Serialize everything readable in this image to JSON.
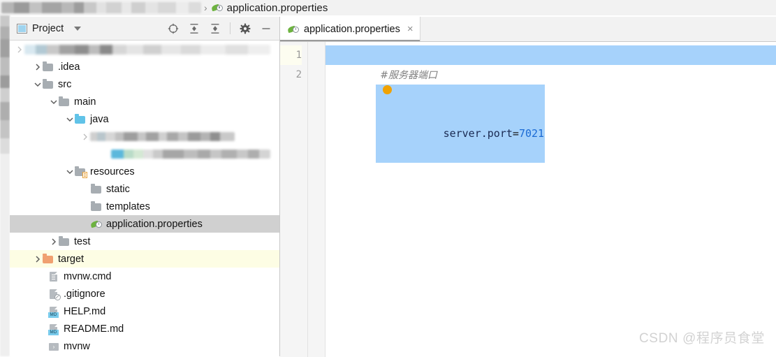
{
  "breadcrumb": {
    "path_redacted": true,
    "separator": "›",
    "current_file": "application.properties"
  },
  "project_panel": {
    "title": "Project",
    "dropdown_caret": "▾",
    "toolbar": [
      {
        "name": "select-opened-file-icon",
        "label": "Select Opened File"
      },
      {
        "name": "expand-all-icon",
        "label": "Expand All"
      },
      {
        "name": "collapse-all-icon",
        "label": "Collapse All"
      },
      {
        "name": "settings-gear-icon",
        "label": "Settings"
      },
      {
        "name": "hide-panel-icon",
        "label": "Hide"
      }
    ],
    "tree": [
      {
        "label": "",
        "redacted": true,
        "kind": "project-root",
        "indent": 0,
        "arrow": "collapsed-faint",
        "state": "none"
      },
      {
        "label": ".idea",
        "kind": "folder",
        "indent": 1,
        "arrow": "collapsed",
        "state": "none"
      },
      {
        "label": "src",
        "kind": "folder",
        "indent": 1,
        "arrow": "expanded",
        "state": "none"
      },
      {
        "label": "main",
        "kind": "folder",
        "indent": 2,
        "arrow": "expanded",
        "state": "none"
      },
      {
        "label": "java",
        "kind": "folder-source",
        "indent": 3,
        "arrow": "expanded",
        "state": "none"
      },
      {
        "label": "",
        "redacted": true,
        "kind": "package",
        "indent": 4,
        "arrow": "collapsed-faint",
        "state": "none"
      },
      {
        "label": "",
        "redacted": true,
        "kind": "package",
        "indent": 5,
        "arrow": "none",
        "state": "none"
      },
      {
        "label": "resources",
        "kind": "folder-resources",
        "indent": 3,
        "arrow": "expanded",
        "state": "none"
      },
      {
        "label": "static",
        "kind": "folder",
        "indent": 4,
        "arrow": "none",
        "state": "none"
      },
      {
        "label": "templates",
        "kind": "folder",
        "indent": 4,
        "arrow": "none",
        "state": "none"
      },
      {
        "label": "application.properties",
        "kind": "spring-properties",
        "indent": 4,
        "arrow": "none",
        "state": "selected"
      },
      {
        "label": "test",
        "kind": "folder",
        "indent": 2,
        "arrow": "collapsed",
        "state": "none"
      },
      {
        "label": "target",
        "kind": "folder-excluded",
        "indent": 1,
        "arrow": "collapsed",
        "state": "excluded"
      },
      {
        "label": "mvnw.cmd",
        "kind": "file-cmd",
        "indent": 2,
        "arrow": "none",
        "state": "none"
      },
      {
        "label": ".gitignore",
        "kind": "file-gitignore",
        "indent": 2,
        "arrow": "none",
        "state": "none"
      },
      {
        "label": "HELP.md",
        "kind": "file-markdown",
        "indent": 2,
        "arrow": "none",
        "state": "none"
      },
      {
        "label": "README.md",
        "kind": "file-markdown",
        "indent": 2,
        "arrow": "none",
        "state": "none"
      },
      {
        "label": "mvnw",
        "kind": "file-shell",
        "indent": 2,
        "arrow": "none",
        "state": "none"
      }
    ],
    "md_badge_text": "MD",
    "sh_badge_text": "›"
  },
  "editor": {
    "tab": {
      "label": "application.properties",
      "close_glyph": "×",
      "icon": "spring-properties-icon"
    },
    "line_numbers": [
      "1",
      "2"
    ],
    "lines": [
      {
        "number": "1",
        "type": "comment",
        "text": "#服务器端口",
        "selected": true
      },
      {
        "number": "2",
        "type": "property",
        "key": "server.port",
        "operator": "=",
        "value": "7021",
        "selected": true
      }
    ],
    "caret_marker": "caret-dot"
  },
  "watermark": {
    "text": "CSDN @程序员食堂"
  },
  "colors": {
    "selection_blue": "#a6d2fb",
    "tree_selected_gray": "#d0d0d0",
    "excluded_yellow": "#fdfde4",
    "spring_green": "#6db33f",
    "source_folder_blue": "#61c3e8",
    "target_orange": "#f0a070",
    "value_blue": "#1a6ad4",
    "caret_orange": "#f0a202"
  }
}
